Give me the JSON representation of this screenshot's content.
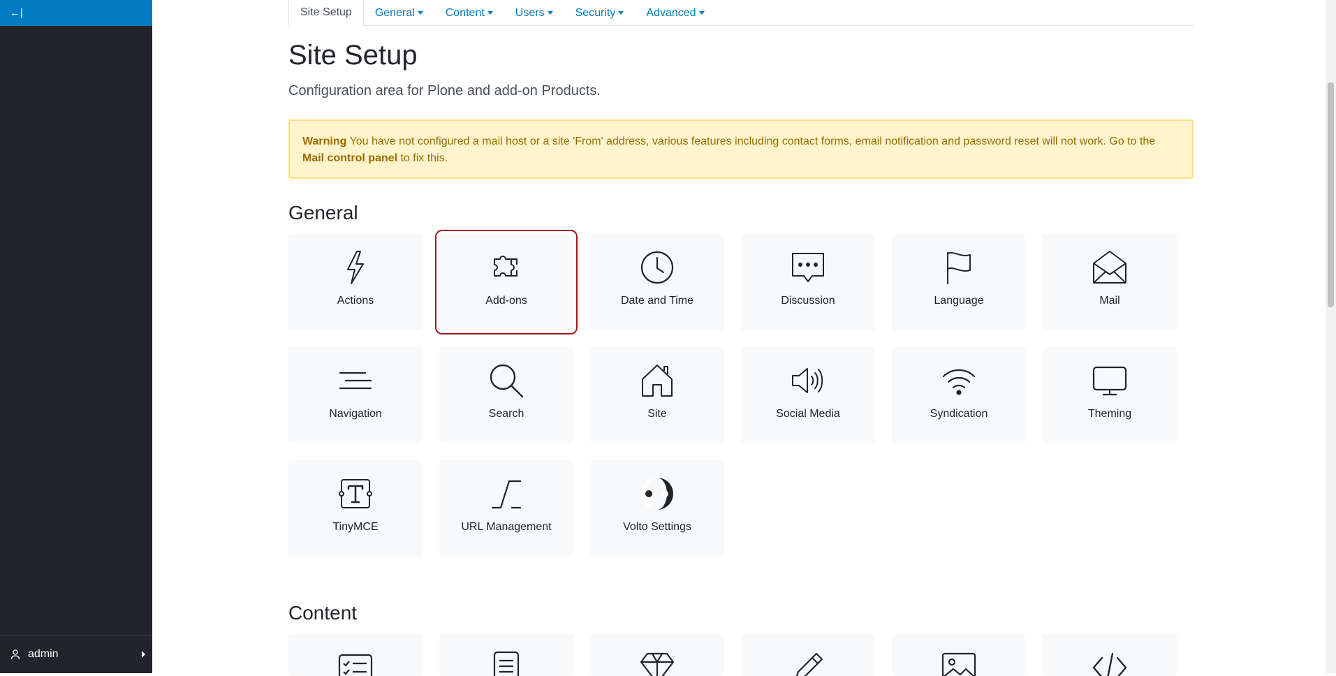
{
  "sidebar": {
    "toggle_label": "←|",
    "user": {
      "name": "admin"
    }
  },
  "tabs": [
    {
      "label": "Site Setup",
      "active": true,
      "dropdown": false
    },
    {
      "label": "General",
      "dropdown": true
    },
    {
      "label": "Content",
      "dropdown": true
    },
    {
      "label": "Users",
      "dropdown": true
    },
    {
      "label": "Security",
      "dropdown": true
    },
    {
      "label": "Advanced",
      "dropdown": true
    }
  ],
  "page": {
    "title": "Site Setup",
    "description": "Configuration area for Plone and add-on Products."
  },
  "warning": {
    "strong": "Warning",
    "text": " You have not configured a mail host or a site 'From' address, various features including contact forms, email notification and password reset will not work. Go to the ",
    "link": "Mail control panel",
    "suffix": " to fix this."
  },
  "sections": {
    "general": {
      "title": "General",
      "items": [
        {
          "label": "Actions",
          "icon": "lightning-icon"
        },
        {
          "label": "Add-ons",
          "icon": "puzzle-icon",
          "selected": true
        },
        {
          "label": "Date and Time",
          "icon": "clock-icon"
        },
        {
          "label": "Discussion",
          "icon": "chat-icon"
        },
        {
          "label": "Language",
          "icon": "flag-icon"
        },
        {
          "label": "Mail",
          "icon": "envelope-icon"
        },
        {
          "label": "Navigation",
          "icon": "navigation-lines-icon"
        },
        {
          "label": "Search",
          "icon": "search-icon"
        },
        {
          "label": "Site",
          "icon": "home-icon"
        },
        {
          "label": "Social Media",
          "icon": "speaker-icon"
        },
        {
          "label": "Syndication",
          "icon": "wifi-icon"
        },
        {
          "label": "Theming",
          "icon": "monitor-icon"
        },
        {
          "label": "TinyMCE",
          "icon": "text-tinymce-icon"
        },
        {
          "label": "URL Management",
          "icon": "url-slash-icon"
        },
        {
          "label": "Volto Settings",
          "icon": "volto-icon"
        }
      ]
    },
    "content": {
      "title": "Content",
      "icons": [
        "checklist-icon",
        "document-icon",
        "diamond-icon",
        "pencil-icon",
        "image-icon",
        "code-icon"
      ]
    }
  },
  "colors": {
    "sidebar_bg": "#212529",
    "sidebar_top": "#007bc1",
    "link": "#007bc1",
    "warning_bg": "#fff4cc",
    "selected_outline": "#a4161a"
  }
}
